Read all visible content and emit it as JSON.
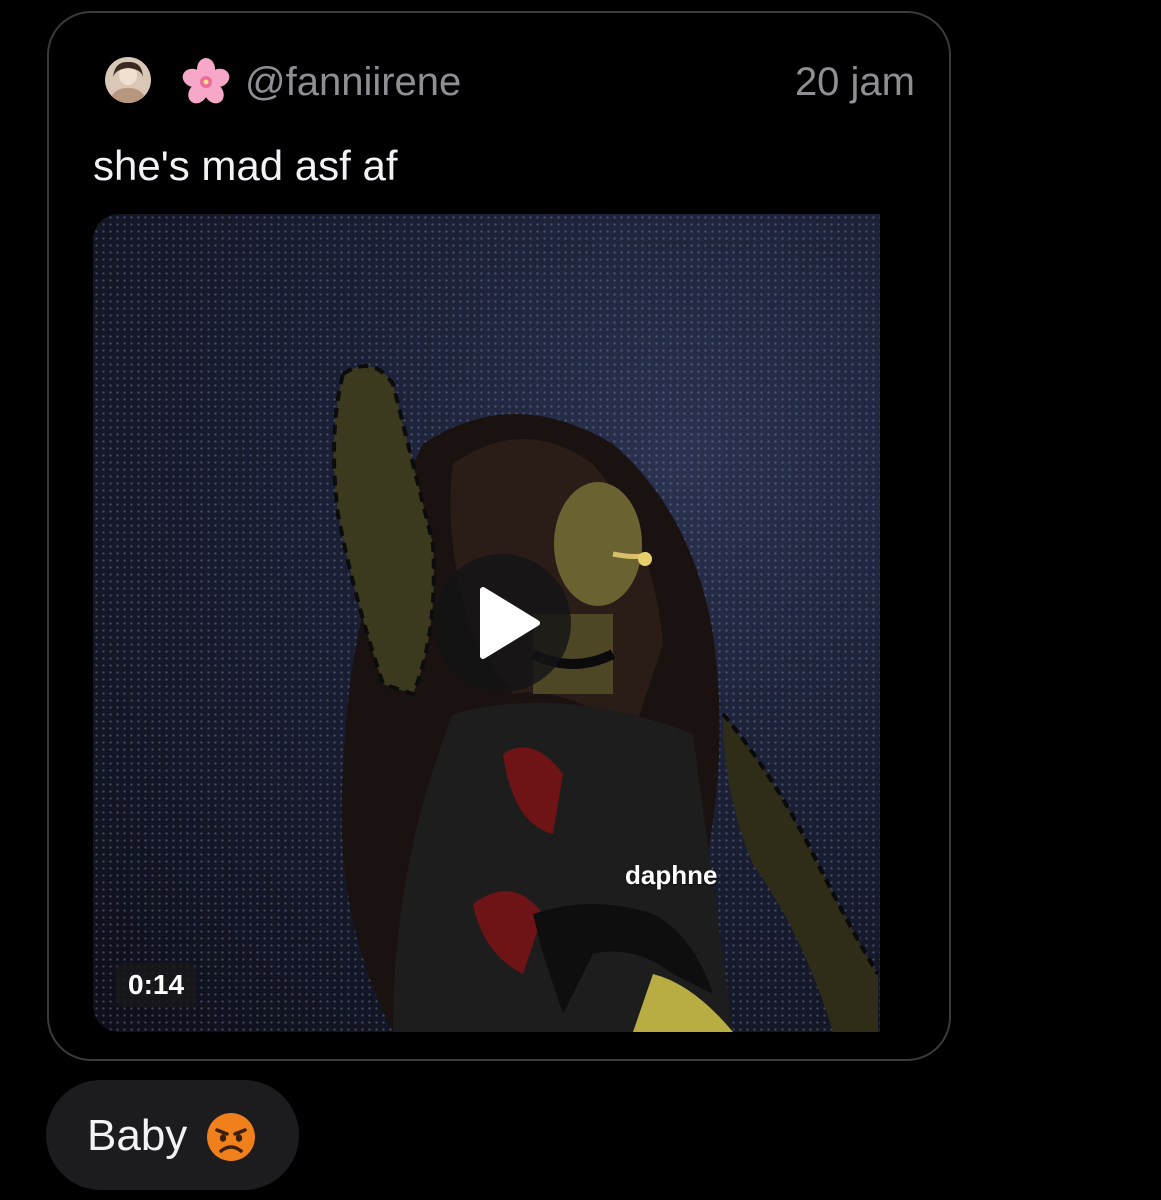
{
  "quoted_post": {
    "author": {
      "avatar_icon": "avatar-photo",
      "flower_emoji": "🌸",
      "handle": "@fanniirene"
    },
    "timestamp": "20 jam",
    "text": "she's mad asf af",
    "media": {
      "type": "video",
      "watermark": "daphne",
      "duration": "0:14",
      "play_icon": "play-icon"
    }
  },
  "reply": {
    "text": "Baby",
    "emoji": "😡"
  },
  "colors": {
    "background": "#000000",
    "card_border": "#3a3a3c",
    "muted_text": "#8e8e93",
    "primary_text": "#f2f2f7",
    "bubble": "#1c1c1e",
    "emoji_orange": "#f0801c"
  }
}
